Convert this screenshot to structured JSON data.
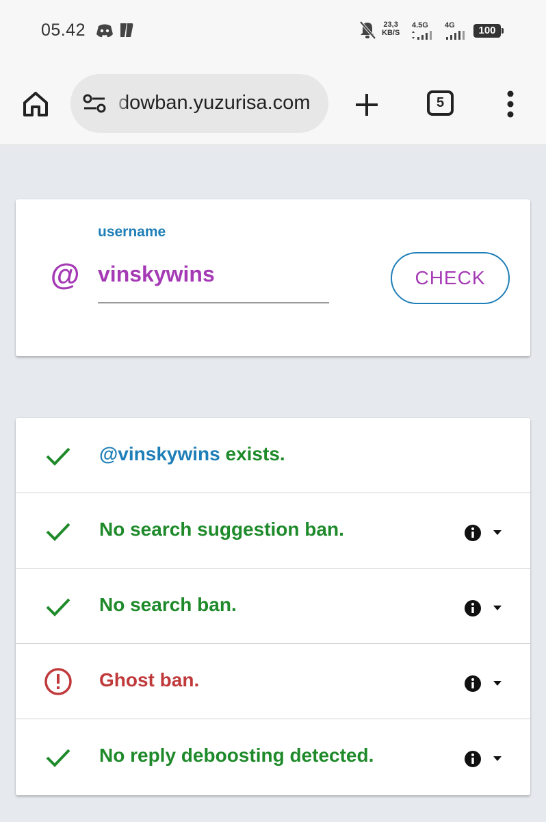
{
  "status_bar": {
    "time": "05.42",
    "net_speed_value": "23,3",
    "net_speed_unit": "KB/S",
    "signal1_label": "4.5G",
    "signal2_label": "4G",
    "battery": "100",
    "icons": [
      "discord-icon",
      "app-icon",
      "bell-off-icon",
      "signal-icon",
      "battery-icon"
    ]
  },
  "browser": {
    "url": "dowban.yuzurisa.com",
    "tab_count": "5",
    "icons": [
      "home-icon",
      "tune-icon",
      "plus-icon",
      "tabs-icon",
      "more-vert-icon"
    ]
  },
  "form": {
    "field_label": "username",
    "value": "vinskywins",
    "prefix": "@",
    "button_label": "CHECK"
  },
  "results": {
    "rows": [
      {
        "status": "ok",
        "handle": "@vinskywins",
        "text": " exists.",
        "has_info": false
      },
      {
        "status": "ok",
        "text": "No search suggestion ban.",
        "has_info": true
      },
      {
        "status": "ok",
        "text": "No search ban.",
        "has_info": true
      },
      {
        "status": "error",
        "text": "Ghost ban.",
        "has_info": true
      },
      {
        "status": "ok",
        "text": "No reply deboosting detected.",
        "has_info": true
      }
    ]
  },
  "colors": {
    "ok": "#1e8a2a",
    "error": "#c0393b",
    "accent_blue": "#1e7eb7",
    "accent_purple": "#a53ab5",
    "background": "#e6eaee"
  }
}
